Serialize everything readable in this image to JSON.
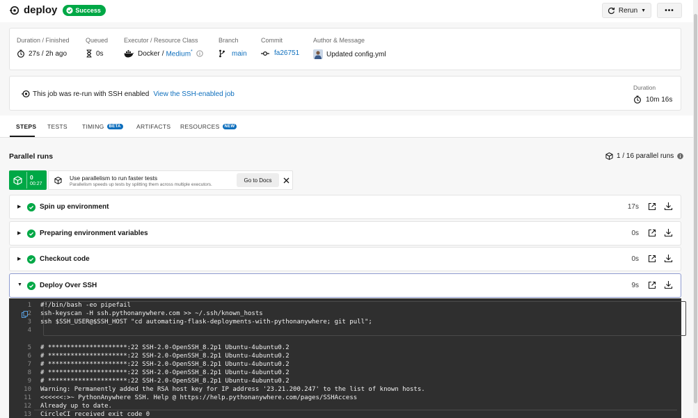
{
  "header": {
    "job_icon": "job-status-icon",
    "title": "deploy",
    "status": "Success",
    "rerun_label": "Rerun",
    "more_label": "•••"
  },
  "meta": {
    "duration": {
      "label": "Duration / Finished",
      "value": "27s / 2h ago"
    },
    "queued": {
      "label": "Queued",
      "value": "0s"
    },
    "executor": {
      "label": "Executor / Resource Class",
      "value": "Docker",
      "separator": "/",
      "resource": "Medium",
      "resource_sup": "*"
    },
    "branch": {
      "label": "Branch",
      "value": "main"
    },
    "commit": {
      "label": "Commit",
      "value": "fa26751"
    },
    "author": {
      "label": "Author & Message",
      "message": "Updated config.yml"
    }
  },
  "rerun_notice": {
    "text": "This job was re-run with SSH enabled",
    "link": "View the SSH-enabled job",
    "duration_label": "Duration",
    "duration_value": "10m 16s"
  },
  "tabs": [
    {
      "label": "STEPS",
      "active": true
    },
    {
      "label": "TESTS"
    },
    {
      "label": "TIMING",
      "badge": "BETA"
    },
    {
      "label": "ARTIFACTS"
    },
    {
      "label": "RESOURCES",
      "badge": "NEW"
    }
  ],
  "parallel": {
    "title": "Parallel runs",
    "runs_count": "1 / 16 parallel runs",
    "run_index": "0",
    "run_time": "00:27",
    "tip_title": "Use parallelism to run faster tests",
    "tip_sub": "Parallelism speeds up tests by splitting them across multiple executors.",
    "docs_button": "Go to Docs"
  },
  "steps": [
    {
      "name": "Spin up environment",
      "duration": "17s"
    },
    {
      "name": "Preparing environment variables",
      "duration": "0s"
    },
    {
      "name": "Checkout code",
      "duration": "0s"
    },
    {
      "name": "Deploy Over SSH",
      "duration": "9s"
    }
  ],
  "terminal": {
    "lines": [
      {
        "no": "1",
        "text": "#!/bin/bash -eo pipefail"
      },
      {
        "no": "2",
        "text": "ssh-keyscan -H ssh.pythonanywhere.com >> ~/.ssh/known_hosts"
      },
      {
        "no": "3",
        "text": "ssh $SSH_USER@$SSH_HOST \"cd automating-flask-deployments-with-pythonanywhere; git pull\";"
      },
      {
        "no": "4",
        "text": ""
      },
      {
        "no": "5",
        "text": "# *********************:22 SSH-2.0-OpenSSH_8.2p1 Ubuntu-4ubuntu0.2"
      },
      {
        "no": "6",
        "text": "# *********************:22 SSH-2.0-OpenSSH_8.2p1 Ubuntu-4ubuntu0.2"
      },
      {
        "no": "7",
        "text": "# *********************:22 SSH-2.0-OpenSSH_8.2p1 Ubuntu-4ubuntu0.2"
      },
      {
        "no": "8",
        "text": "# *********************:22 SSH-2.0-OpenSSH_8.2p1 Ubuntu-4ubuntu0.2"
      },
      {
        "no": "9",
        "text": "# *********************:22 SSH-2.0-OpenSSH_8.2p1 Ubuntu-4ubuntu0.2"
      },
      {
        "no": "10",
        "text": "Warning: Permanently added the RSA host key for IP address '23.21.200.247' to the list of known hosts."
      },
      {
        "no": "11",
        "text": "<<<<<<:>~ PythonAnywhere SSH. Help @ https://help.pythonanywhere.com/pages/SSHAccess"
      },
      {
        "no": "12",
        "text": "Already up to date."
      },
      {
        "no": "13",
        "text": "CircleCI received exit code 0"
      }
    ]
  },
  "colors": {
    "success": "#00a846",
    "link": "#0e6fbd",
    "terminal_bg": "#2f2f2f"
  }
}
